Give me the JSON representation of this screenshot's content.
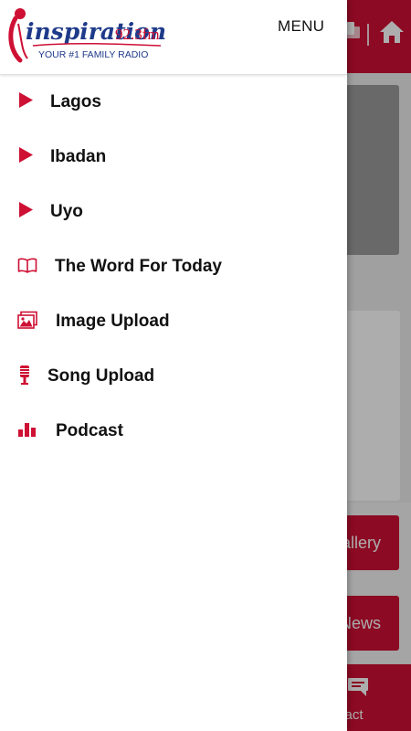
{
  "app": {
    "brand_name": "inspiration",
    "frequency": "92.3fm",
    "tagline": "YOUR #1 FAMILY RADIO",
    "accent_color": "#ce1034"
  },
  "drawer": {
    "menu_label": "MENU",
    "items": [
      {
        "label": "Lagos",
        "icon": "play-icon"
      },
      {
        "label": "Ibadan",
        "icon": "play-icon"
      },
      {
        "label": "Uyo",
        "icon": "play-icon"
      },
      {
        "label": "The Word For Today",
        "icon": "book-icon"
      },
      {
        "label": "Image Upload",
        "icon": "image-icon"
      },
      {
        "label": "Song Upload",
        "icon": "microphone-icon"
      },
      {
        "label": "Podcast",
        "icon": "bar-chart-icon"
      }
    ]
  },
  "background": {
    "gallery_label": "allery",
    "news_label": "News",
    "contact_label": "ntact"
  }
}
